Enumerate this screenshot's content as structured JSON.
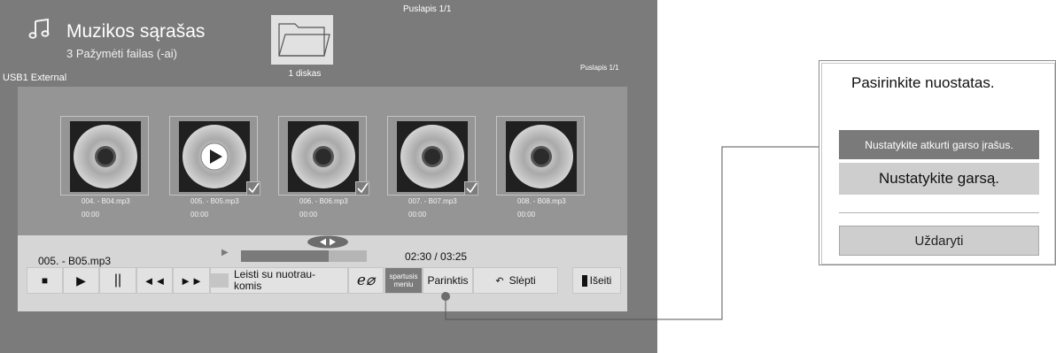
{
  "header": {
    "title": "Muzikos sąrašas",
    "subtitle": "3 Pažymėti failas (-ai)",
    "device": "USB1 External",
    "page_top": "Puslapis 1/1",
    "page_right": "Puslapis 1/1",
    "folder_label": "1 diskas",
    "note_icon": "music-note-icon",
    "folder_icon": "folder-icon"
  },
  "tracks": [
    {
      "name": "004. - B04.mp3",
      "time": "00:00",
      "checked": false,
      "playing": false
    },
    {
      "name": "005. - B05.mp3",
      "time": "00:00",
      "checked": true,
      "playing": true
    },
    {
      "name": "006. - B06.mp3",
      "time": "00:00",
      "checked": true,
      "playing": false
    },
    {
      "name": "007. - B07.mp3",
      "time": "00:00",
      "checked": true,
      "playing": false
    },
    {
      "name": "008. - B08.mp3",
      "time": "00:00",
      "checked": false,
      "playing": false
    }
  ],
  "player": {
    "current_track": "005. - B05.mp3",
    "time": "02:30 / 03:25",
    "progress_fraction": 0.7,
    "buttons": {
      "stop": "■",
      "play": "▶",
      "pause": "||",
      "prev": "◄◄",
      "next": "►►",
      "play_with_photo": "Leisti su nuotrau-\nkomis",
      "energy": "e",
      "quick_menu": "spartusis\nmeniu",
      "option": "Parinktis",
      "hide": "Slėpti",
      "exit": "Išeiti"
    }
  },
  "options_panel": {
    "title": "Pasirinkite nuostatas.",
    "item_1": "Nustatykite atkurti garso įrašus.",
    "item_2": "Nustatykite garsą.",
    "close": "Uždaryti"
  },
  "colors": {
    "screen_bg": "#7b7b7b",
    "content_bg": "#959595",
    "bar_bg": "#d6d6d6",
    "highlight": "#7a7a7a"
  }
}
